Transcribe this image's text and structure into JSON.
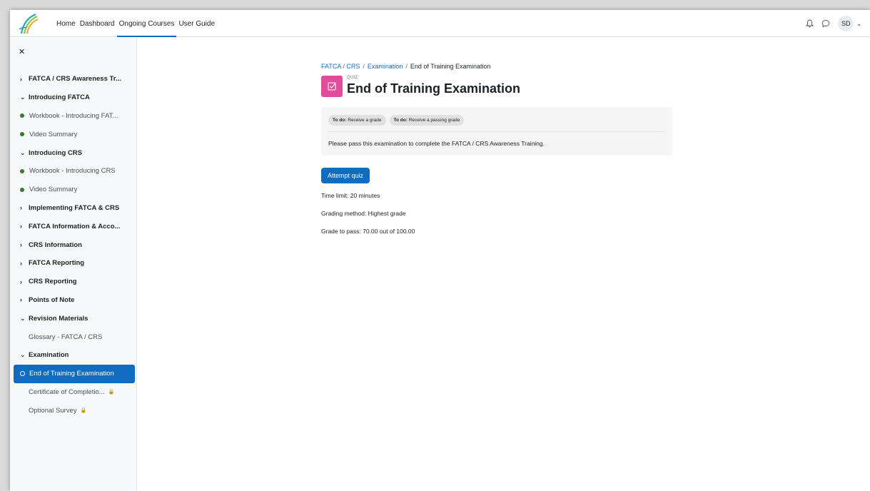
{
  "navbar": {
    "links": [
      {
        "label": "Home",
        "active": false
      },
      {
        "label": "Dashboard",
        "active": false
      },
      {
        "label": "Ongoing Courses",
        "active": true
      },
      {
        "label": "User Guide",
        "active": false
      }
    ],
    "user_initials": "SD",
    "icons": [
      "bell-icon",
      "chat-icon",
      "chevron-down-icon"
    ]
  },
  "sidebar": {
    "close_icon": "close-icon",
    "items": [
      {
        "label": "FATCA / CRS Awareness Tr...",
        "type": "section",
        "expanded": false
      },
      {
        "label": "Introducing FATCA",
        "type": "section",
        "expanded": true
      },
      {
        "label": "Workbook - Introducing FAT...",
        "type": "activity",
        "complete": true
      },
      {
        "label": "Video Summary",
        "type": "activity",
        "complete": true
      },
      {
        "label": "Introducing CRS",
        "type": "section",
        "expanded": true
      },
      {
        "label": "Workbook - Introducing CRS",
        "type": "activity",
        "complete": true
      },
      {
        "label": "Video Summary",
        "type": "activity",
        "complete": true
      },
      {
        "label": "Implementing FATCA & CRS",
        "type": "section",
        "expanded": false
      },
      {
        "label": "FATCA Information & Acco...",
        "type": "section",
        "expanded": false
      },
      {
        "label": "CRS Information",
        "type": "section",
        "expanded": false
      },
      {
        "label": "FATCA Reporting",
        "type": "section",
        "expanded": false
      },
      {
        "label": "CRS Reporting",
        "type": "section",
        "expanded": false
      },
      {
        "label": "Points of Note",
        "type": "section",
        "expanded": false
      },
      {
        "label": "Revision Materials",
        "type": "section",
        "expanded": true
      },
      {
        "label": "Glossary - FATCA / CRS",
        "type": "plain"
      },
      {
        "label": "Examination",
        "type": "section",
        "expanded": true
      },
      {
        "label": "End of Training Examination",
        "type": "current"
      },
      {
        "label": "Certificate of Completio...",
        "type": "plain",
        "locked": true
      },
      {
        "label": "Optional Survey",
        "type": "plain",
        "locked": true
      }
    ]
  },
  "breadcrumb": {
    "items": [
      "FATCA / CRS",
      "Examination"
    ],
    "current": "End of Training Examination"
  },
  "header": {
    "module_label": "QUIZ",
    "title": "End of Training Examination",
    "icon_color": "#e24c9d"
  },
  "completion": {
    "badges": [
      {
        "prefix": "To do:",
        "text": "Receive a grade"
      },
      {
        "prefix": "To do:",
        "text": "Receive a passing grade"
      }
    ],
    "description": "Please pass this examination to complete the FATCA / CRS Awareness Training."
  },
  "quiz": {
    "attempt_label": "Attempt quiz",
    "time_limit": "Time limit: 20 minutes",
    "grading_method": "Grading method: Highest grade",
    "grade_to_pass": "Grade to pass: 70.00 out of 100.00"
  },
  "colors": {
    "primary": "#0f6cbf",
    "complete": "#357a32"
  }
}
